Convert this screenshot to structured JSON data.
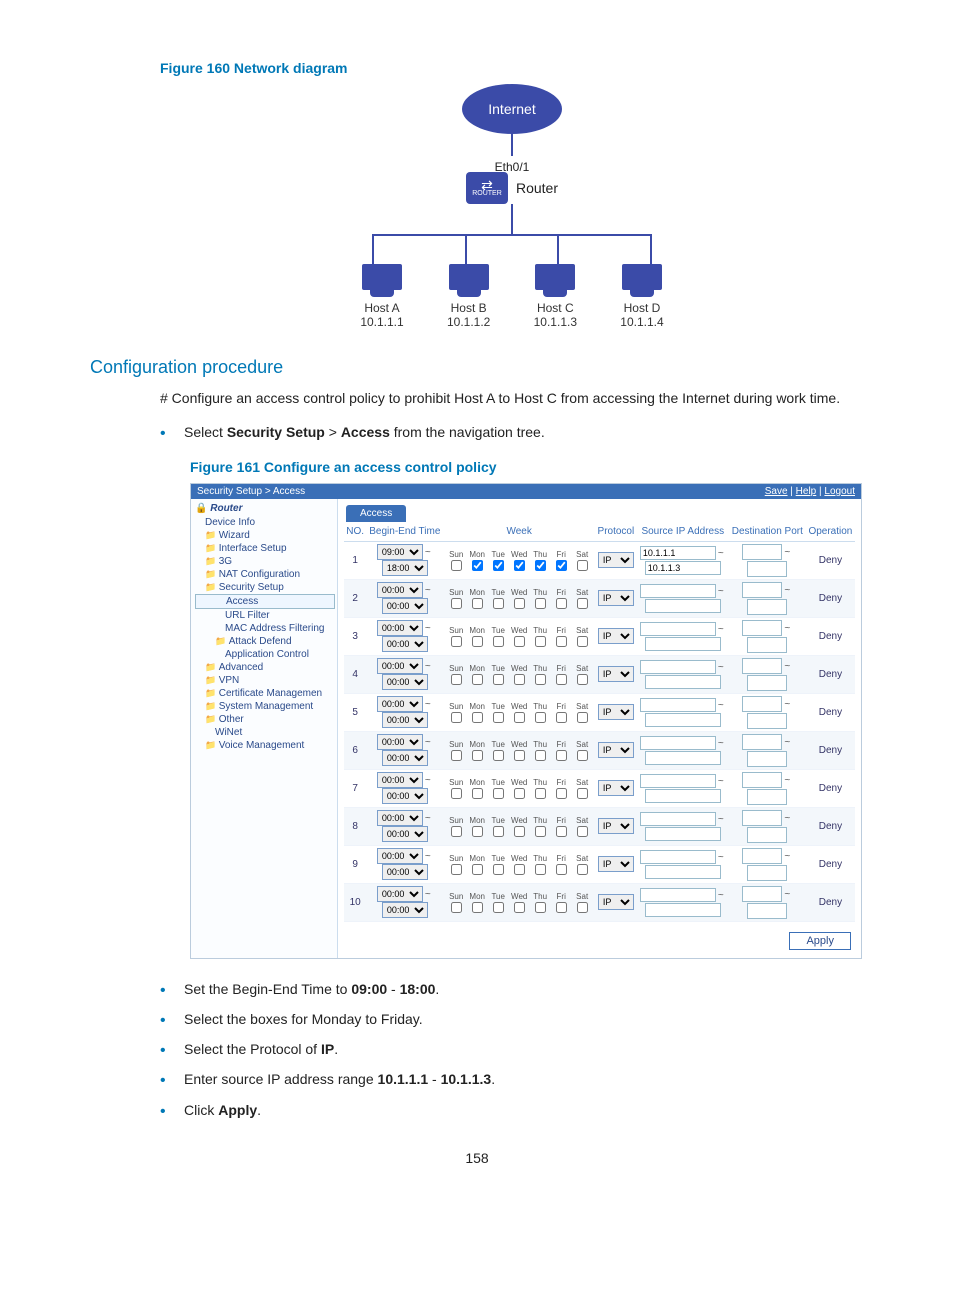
{
  "figure160": {
    "title": "Figure 160 Network diagram",
    "internet": "Internet",
    "iface": "Eth0/1",
    "router": "Router",
    "router_small": "ROUTER",
    "hosts": [
      {
        "name": "Host A",
        "ip": "10.1.1.1"
      },
      {
        "name": "Host B",
        "ip": "10.1.1.2"
      },
      {
        "name": "Host C",
        "ip": "10.1.1.3"
      },
      {
        "name": "Host D",
        "ip": "10.1.1.4"
      }
    ]
  },
  "section": {
    "title": "Configuration procedure",
    "intro": "# Configure an access control policy to prohibit Host A to Host C from accessing the Internet during work time.",
    "step1_pre": "Select ",
    "step1_b1": "Security Setup",
    "step1_sep": " > ",
    "step1_b2": "Access",
    "step1_post": " from the navigation tree."
  },
  "figure161": {
    "title": "Figure 161 Configure an access control policy"
  },
  "shot": {
    "breadcrumb": "Security Setup > Access",
    "links": {
      "save": "Save",
      "help": "Help",
      "logout": "Logout"
    },
    "root": "Router",
    "nav": [
      {
        "label": "Device Info",
        "cls": ""
      },
      {
        "label": "Wizard",
        "cls": "folder"
      },
      {
        "label": "Interface Setup",
        "cls": "folder"
      },
      {
        "label": "3G",
        "cls": "folder"
      },
      {
        "label": "NAT Configuration",
        "cls": "folder"
      },
      {
        "label": "Security Setup",
        "cls": "folder"
      },
      {
        "label": "Access",
        "cls": "l3 selected"
      },
      {
        "label": "URL Filter",
        "cls": "l3"
      },
      {
        "label": "MAC Address Filtering",
        "cls": "l3"
      },
      {
        "label": "Attack Defend",
        "cls": "folder l2"
      },
      {
        "label": "Application Control",
        "cls": "l3"
      },
      {
        "label": "Advanced",
        "cls": "folder"
      },
      {
        "label": "VPN",
        "cls": "folder"
      },
      {
        "label": "Certificate Managemen",
        "cls": "folder"
      },
      {
        "label": "System Management",
        "cls": "folder"
      },
      {
        "label": "Other",
        "cls": "folder"
      },
      {
        "label": "WiNet",
        "cls": "l2"
      },
      {
        "label": "Voice Management",
        "cls": "folder"
      }
    ],
    "tab": "Access",
    "headers": {
      "no": "NO.",
      "time": "Begin-End Time",
      "week": "Week",
      "proto": "Protocol",
      "src": "Source IP Address",
      "dest": "Destination Port",
      "op": "Operation"
    },
    "days": [
      "Sun",
      "Mon",
      "Tue",
      "Wed",
      "Thu",
      "Fri",
      "Sat"
    ],
    "rows": [
      {
        "no": 1,
        "begin": "09:00",
        "end": "18:00",
        "checked": [
          false,
          true,
          true,
          true,
          true,
          true,
          false
        ],
        "proto": "IP",
        "src1": "10.1.1.1",
        "src2": "10.1.1.3",
        "op": "Deny"
      },
      {
        "no": 2,
        "begin": "00:00",
        "end": "00:00",
        "checked": [
          false,
          false,
          false,
          false,
          false,
          false,
          false
        ],
        "proto": "IP",
        "src1": "",
        "src2": "",
        "op": "Deny"
      },
      {
        "no": 3,
        "begin": "00:00",
        "end": "00:00",
        "checked": [
          false,
          false,
          false,
          false,
          false,
          false,
          false
        ],
        "proto": "IP",
        "src1": "",
        "src2": "",
        "op": "Deny"
      },
      {
        "no": 4,
        "begin": "00:00",
        "end": "00:00",
        "checked": [
          false,
          false,
          false,
          false,
          false,
          false,
          false
        ],
        "proto": "IP",
        "src1": "",
        "src2": "",
        "op": "Deny"
      },
      {
        "no": 5,
        "begin": "00:00",
        "end": "00:00",
        "checked": [
          false,
          false,
          false,
          false,
          false,
          false,
          false
        ],
        "proto": "IP",
        "src1": "",
        "src2": "",
        "op": "Deny"
      },
      {
        "no": 6,
        "begin": "00:00",
        "end": "00:00",
        "checked": [
          false,
          false,
          false,
          false,
          false,
          false,
          false
        ],
        "proto": "IP",
        "src1": "",
        "src2": "",
        "op": "Deny"
      },
      {
        "no": 7,
        "begin": "00:00",
        "end": "00:00",
        "checked": [
          false,
          false,
          false,
          false,
          false,
          false,
          false
        ],
        "proto": "IP",
        "src1": "",
        "src2": "",
        "op": "Deny"
      },
      {
        "no": 8,
        "begin": "00:00",
        "end": "00:00",
        "checked": [
          false,
          false,
          false,
          false,
          false,
          false,
          false
        ],
        "proto": "IP",
        "src1": "",
        "src2": "",
        "op": "Deny"
      },
      {
        "no": 9,
        "begin": "00:00",
        "end": "00:00",
        "checked": [
          false,
          false,
          false,
          false,
          false,
          false,
          false
        ],
        "proto": "IP",
        "src1": "",
        "src2": "",
        "op": "Deny"
      },
      {
        "no": 10,
        "begin": "00:00",
        "end": "00:00",
        "checked": [
          false,
          false,
          false,
          false,
          false,
          false,
          false
        ],
        "proto": "IP",
        "src1": "",
        "src2": "",
        "op": "Deny"
      }
    ],
    "apply": "Apply"
  },
  "steps": {
    "s1a": "Set the Begin-End Time to ",
    "s1b": "09:00",
    "s1c": " - ",
    "s1d": "18:00",
    "s1e": ".",
    "s2": "Select the boxes for Monday to Friday.",
    "s3a": "Select the Protocol of ",
    "s3b": "IP",
    "s3c": ".",
    "s4a": "Enter source IP address range ",
    "s4b": "10.1.1.1",
    "s4c": " - ",
    "s4d": "10.1.1.3",
    "s4e": ".",
    "s5a": "Click ",
    "s5b": "Apply",
    "s5c": "."
  },
  "pagenum": "158"
}
